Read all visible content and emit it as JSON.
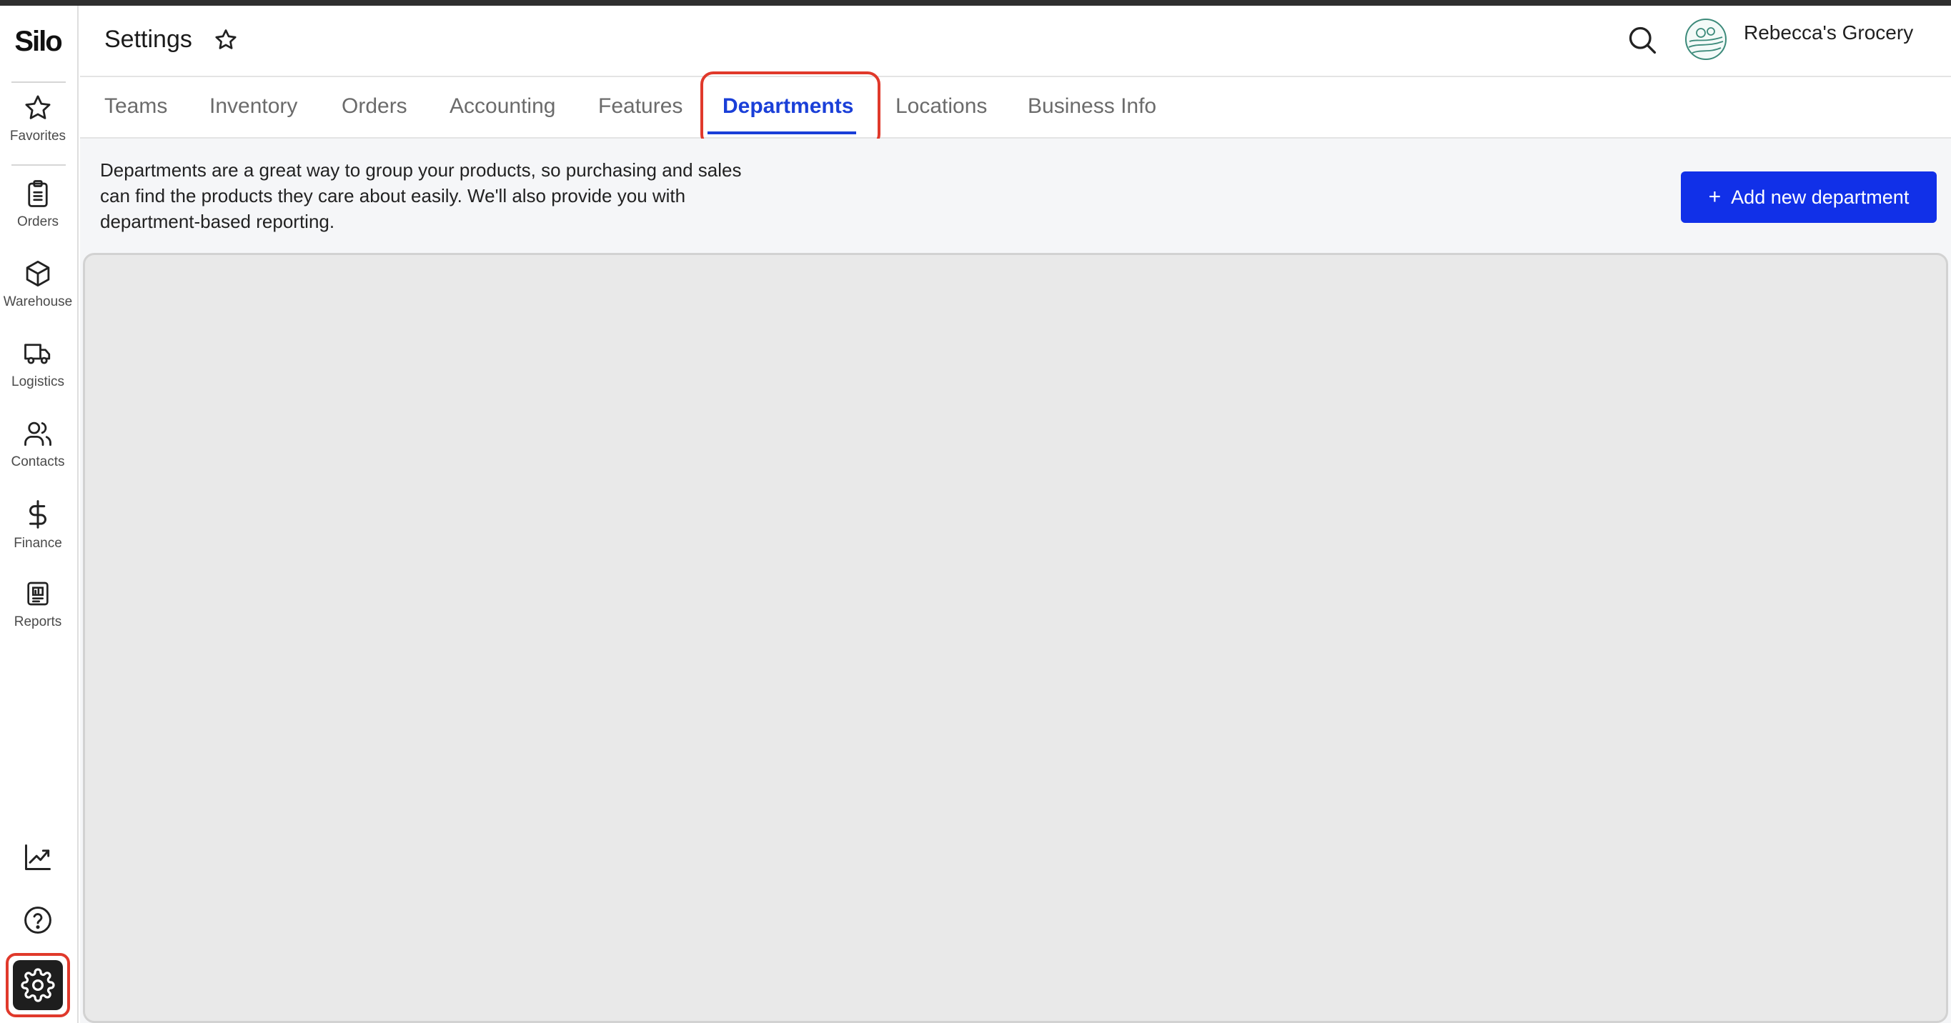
{
  "app": {
    "logo": "Silo"
  },
  "sidebar": {
    "items": [
      {
        "label": "Favorites",
        "icon": "star-icon"
      },
      {
        "label": "Orders",
        "icon": "clipboard-icon"
      },
      {
        "label": "Warehouse",
        "icon": "box-icon"
      },
      {
        "label": "Logistics",
        "icon": "truck-icon"
      },
      {
        "label": "Contacts",
        "icon": "users-icon"
      },
      {
        "label": "Finance",
        "icon": "dollar-icon"
      },
      {
        "label": "Reports",
        "icon": "report-icon"
      }
    ],
    "bottom": [
      {
        "icon": "trending-up-icon"
      },
      {
        "icon": "help-icon"
      },
      {
        "icon": "gear-icon"
      }
    ]
  },
  "header": {
    "title": "Settings",
    "account_name": "Rebecca's Grocery"
  },
  "tabs": [
    {
      "label": "Teams"
    },
    {
      "label": "Inventory"
    },
    {
      "label": "Orders"
    },
    {
      "label": "Accounting"
    },
    {
      "label": "Features"
    },
    {
      "label": "Departments",
      "active": true
    },
    {
      "label": "Locations"
    },
    {
      "label": "Business Info"
    }
  ],
  "content": {
    "description": "Departments are a great way to group your products, so purchasing and sales can find the products they care about easily. We'll also provide you with department-based reporting.",
    "add_button_label": "Add new department",
    "add_button_icon": "+"
  },
  "colors": {
    "accent": "#1130e8",
    "active_tab": "#1a3fd8",
    "highlight": "#e0392b"
  }
}
